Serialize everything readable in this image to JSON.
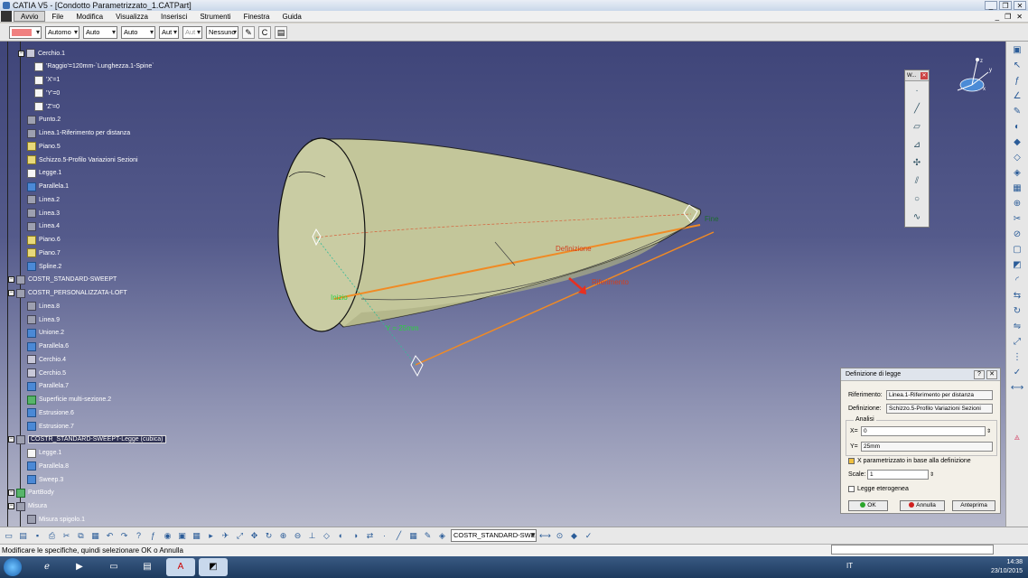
{
  "window": {
    "title": "CATIA V5 - [Condotto Parametrizzato_1.CATPart]",
    "controls": [
      "_",
      "❐",
      "✕"
    ]
  },
  "menu": {
    "items": [
      "Avvio",
      "File",
      "Modifica",
      "Visualizza",
      "Inserisci",
      "Strumenti",
      "Finestra",
      "Guida"
    ],
    "active": "Avvio"
  },
  "format_toolbar": {
    "color_swatch": "#f08080",
    "combos": [
      "Automo",
      "Auto",
      "Auto",
      "Aut",
      "Aut",
      "Nessuno"
    ]
  },
  "tree": {
    "items": [
      {
        "label": "Cerchio.1",
        "icon": "circle-icon"
      },
      {
        "label": "'Raggio'=120mm-`Lunghezza.1-Spine`",
        "icon": "formula-icon"
      },
      {
        "label": "'X'=1",
        "icon": "formula-icon"
      },
      {
        "label": "'Y'=0",
        "icon": "formula-icon"
      },
      {
        "label": "'Z'=0",
        "icon": "formula-icon"
      },
      {
        "label": "Punto.2",
        "icon": "point-icon"
      },
      {
        "label": "Linea.1-Riferimento per distanza",
        "icon": "line-icon"
      },
      {
        "label": "Piano.5",
        "icon": "plane-icon"
      },
      {
        "label": "Schizzo.5-Profilo Variazioni Sezioni",
        "icon": "sketch-icon"
      },
      {
        "label": "Legge.1",
        "icon": "law-icon"
      },
      {
        "label": "Parallela.1",
        "icon": "parallel-icon"
      },
      {
        "label": "Linea.2",
        "icon": "line-icon"
      },
      {
        "label": "Linea.3",
        "icon": "line-icon"
      },
      {
        "label": "Linea.4",
        "icon": "line-icon"
      },
      {
        "label": "Piano.6",
        "icon": "plane-icon"
      },
      {
        "label": "Piano.7",
        "icon": "plane-icon"
      },
      {
        "label": "Spline.2",
        "icon": "spline-icon"
      },
      {
        "label": "COSTR_STANDARD-SWEEPT",
        "icon": "geoset-icon"
      },
      {
        "label": "COSTR_PERSONALIZZATA-LOFT",
        "icon": "geoset-icon"
      },
      {
        "label": "Linea.8",
        "icon": "line-icon"
      },
      {
        "label": "Linea.9",
        "icon": "line-icon"
      },
      {
        "label": "Unione.2",
        "icon": "join-icon"
      },
      {
        "label": "Parallela.6",
        "icon": "parallel-icon"
      },
      {
        "label": "Cerchio.4",
        "icon": "circle-icon"
      },
      {
        "label": "Cerchio.5",
        "icon": "circle-icon"
      },
      {
        "label": "Parallela.7",
        "icon": "parallel-icon"
      },
      {
        "label": "Superficie multi-sezione.2",
        "icon": "multisection-icon"
      },
      {
        "label": "Estrusione.6",
        "icon": "extrude-icon"
      },
      {
        "label": "Estrusione.7",
        "icon": "extrude-icon"
      },
      {
        "label": "COSTR_STANDARD-SWEEPT-Legge (cubica)",
        "icon": "geoset-icon"
      },
      {
        "label": "Legge.1",
        "icon": "law-icon"
      },
      {
        "label": "Parallela.8",
        "icon": "parallel-icon"
      },
      {
        "label": "Sweep.3",
        "icon": "sweep-icon"
      },
      {
        "label": "PartBody",
        "icon": "partbody-icon"
      },
      {
        "label": "Misura",
        "icon": "measure-icon"
      },
      {
        "label": "Misura spigolo.1",
        "icon": "measure-icon"
      }
    ]
  },
  "viewport": {
    "labels": {
      "fine": "Fine",
      "definizione": "Definizione",
      "riferimento": "Riferimento",
      "inizio": "Inizio",
      "y_value": "Y = 25mm"
    },
    "compass_axes": [
      "x",
      "y",
      "z"
    ]
  },
  "palette": {
    "title": "W..."
  },
  "dialog": {
    "title": "Definizione di legge",
    "title_buttons": [
      "?",
      "✕"
    ],
    "riferimento_label": "Riferimento:",
    "riferimento_value": "Linea.1-Riferimento per distanza",
    "definizione_label": "Definizione:",
    "definizione_value": "Schizzo.5-Profilo Variazioni Sezioni",
    "analisi_label": "Analisi",
    "x_label": "X=",
    "x_value": "0",
    "y_label": "Y=",
    "y_value": "25mm",
    "param_label": "X parametrizzato in base alla definizione",
    "scale_label": "Scale:",
    "scale_value": "1",
    "heterogeneous_label": "Legge eterogenea",
    "ok_label": "OK",
    "cancel_label": "Annulla",
    "preview_label": "Anteprima"
  },
  "bottom_toolbar": {
    "set_combo": "COSTR_STANDARD-SWEEP"
  },
  "status": {
    "message": "Modificare le specifiche, quindi selezionare OK o Annulla"
  },
  "taskbar": {
    "lang": "IT",
    "time": "14:38",
    "date": "23/10/2015"
  }
}
